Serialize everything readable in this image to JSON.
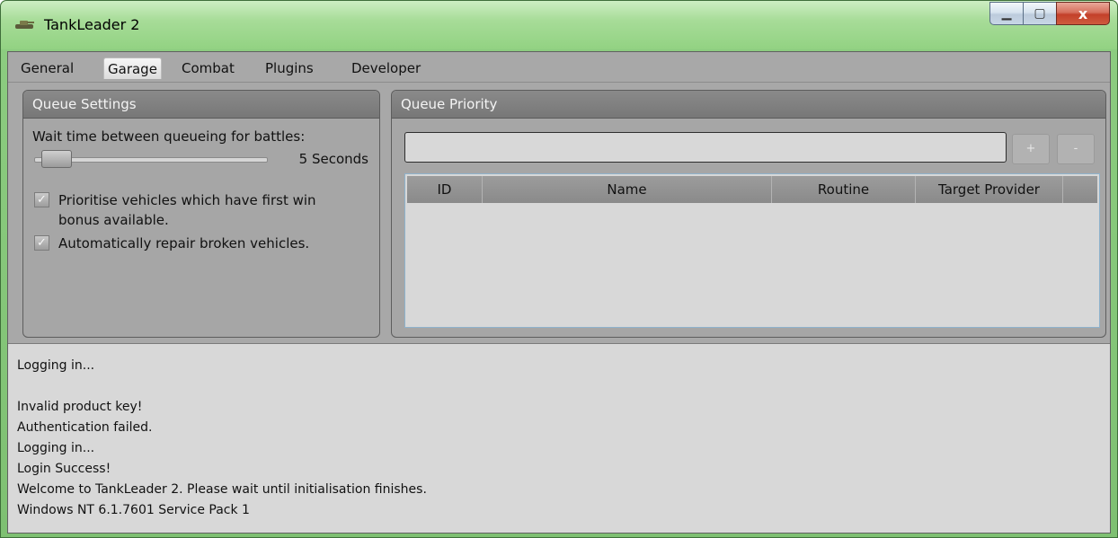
{
  "window": {
    "title": "TankLeader 2",
    "app_icon": "tank-icon",
    "controls": [
      {
        "name": "minimize",
        "glyph": "▁"
      },
      {
        "name": "maximize",
        "glyph": "▢"
      },
      {
        "name": "close",
        "glyph": "x"
      }
    ]
  },
  "tabs": [
    {
      "label": "General"
    },
    {
      "label": "Garage",
      "active": true
    },
    {
      "label": "Combat"
    },
    {
      "label": "Plugins"
    },
    {
      "label": "Developer"
    }
  ],
  "queue_settings": {
    "header": "Queue Settings",
    "wait_label": "Wait time between queueing for battles:",
    "wait_value": "5 Seconds",
    "checkboxes": [
      {
        "label": "Prioritise vehicles which have first win bonus available.",
        "checked": true,
        "glyph": "✓"
      },
      {
        "label": "Automatically repair broken vehicles.",
        "checked": true,
        "glyph": "✓"
      }
    ]
  },
  "queue_priority": {
    "header": "Queue Priority",
    "search_value": "",
    "add_label": "+",
    "remove_label": "-",
    "columns": [
      "ID",
      "Name",
      "Routine",
      "Target Provider"
    ],
    "rows": []
  },
  "log": {
    "lines": [
      "Logging in...",
      "",
      "Invalid product key!",
      "Authentication failed.",
      "Logging in...",
      "Login Success!",
      "Welcome to TankLeader 2. Please wait until initialisation finishes.",
      "Windows NT 6.1.7601 Service Pack 1"
    ]
  },
  "colors": {
    "titlebar": "#a7dc98",
    "panel_header": "#7f7f7f",
    "client_bg": "#a8a8a8",
    "log_bg": "#d8d8d8"
  }
}
